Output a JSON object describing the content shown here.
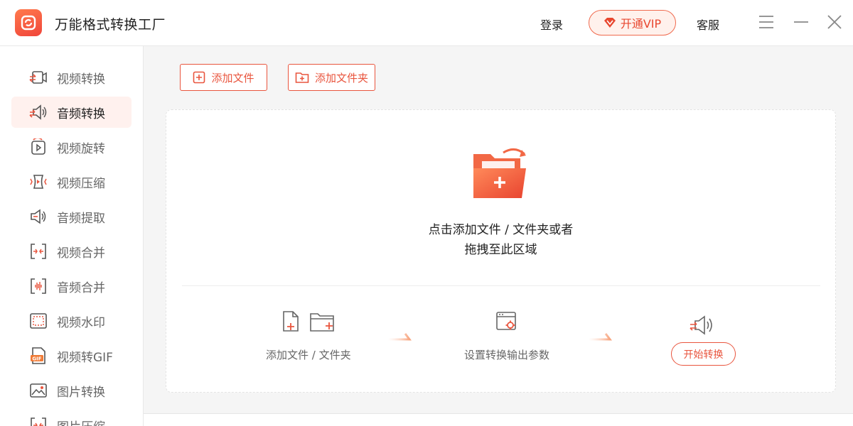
{
  "app": {
    "title": "万能格式转换工厂"
  },
  "header": {
    "login": "登录",
    "vip": "开通VIP",
    "service": "客服"
  },
  "sidebar": {
    "items": [
      {
        "label": "视频转换",
        "icon": "video-convert-icon"
      },
      {
        "label": "音频转换",
        "icon": "audio-convert-icon",
        "active": true
      },
      {
        "label": "视频旋转",
        "icon": "video-rotate-icon"
      },
      {
        "label": "视频压缩",
        "icon": "video-compress-icon"
      },
      {
        "label": "音频提取",
        "icon": "audio-extract-icon"
      },
      {
        "label": "视频合并",
        "icon": "video-merge-icon"
      },
      {
        "label": "音频合并",
        "icon": "audio-merge-icon"
      },
      {
        "label": "视频水印",
        "icon": "video-watermark-icon"
      },
      {
        "label": "视频转GIF",
        "icon": "video-gif-icon"
      },
      {
        "label": "图片转换",
        "icon": "image-convert-icon"
      },
      {
        "label": "图片压缩",
        "icon": "image-compress-icon"
      }
    ]
  },
  "toolbar": {
    "add_file": "添加文件",
    "add_folder": "添加文件夹"
  },
  "dropzone": {
    "line1": "点击添加文件 / 文件夹或者",
    "line2": "拖拽至此区域"
  },
  "steps": {
    "step1": "添加文件 / 文件夹",
    "step2": "设置转换输出参数",
    "start": "开始转换"
  },
  "colors": {
    "accent": "#e9553e",
    "active_bg": "#fff1ee"
  }
}
